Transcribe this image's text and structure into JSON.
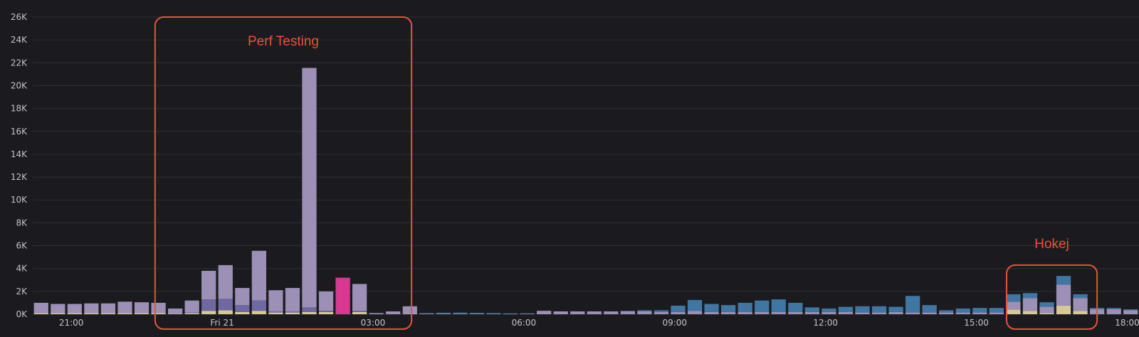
{
  "colors": {
    "background": "#1b1b1f",
    "grid": "#2f2f35",
    "tick_text": "#c4c4c8",
    "annotation": "#e8513a"
  },
  "chart_data": {
    "type": "bar",
    "stacked": true,
    "grid": true,
    "legend": "none",
    "ylim": [
      0,
      26000
    ],
    "y_ticks": [
      {
        "value": 0,
        "label": "0K"
      },
      {
        "value": 2000,
        "label": "2K"
      },
      {
        "value": 4000,
        "label": "4K"
      },
      {
        "value": 6000,
        "label": "6K"
      },
      {
        "value": 8000,
        "label": "8K"
      },
      {
        "value": 10000,
        "label": "10K"
      },
      {
        "value": 12000,
        "label": "12K"
      },
      {
        "value": 14000,
        "label": "14K"
      },
      {
        "value": 16000,
        "label": "16K"
      },
      {
        "value": 18000,
        "label": "18K"
      },
      {
        "value": 20000,
        "label": "20K"
      },
      {
        "value": 22000,
        "label": "22K"
      },
      {
        "value": 24000,
        "label": "24K"
      },
      {
        "value": 26000,
        "label": "26K"
      }
    ],
    "x_ticks": [
      {
        "index": 2.3,
        "label": "21:00"
      },
      {
        "index": 11.3,
        "label": "Fri 21"
      },
      {
        "index": 20.3,
        "label": "03:00"
      },
      {
        "index": 29.3,
        "label": "06:00"
      },
      {
        "index": 38.3,
        "label": "09:00"
      },
      {
        "index": 47.3,
        "label": "12:00"
      },
      {
        "index": 56.3,
        "label": "15:00"
      },
      {
        "index": 65.3,
        "label": "18:00"
      }
    ],
    "series": [
      {
        "color": "#d6c997",
        "values": [
          100,
          100,
          100,
          100,
          100,
          100,
          100,
          100,
          50,
          100,
          300,
          350,
          200,
          300,
          150,
          150,
          200,
          200,
          0,
          200,
          0,
          0,
          50,
          0,
          0,
          0,
          0,
          0,
          0,
          0,
          0,
          0,
          0,
          0,
          0,
          0,
          0,
          0,
          0,
          0,
          0,
          0,
          0,
          0,
          0,
          0,
          0,
          0,
          0,
          0,
          0,
          0,
          0,
          0,
          0,
          0,
          0,
          0,
          400,
          300,
          100,
          750,
          300,
          0,
          0,
          0
        ]
      },
      {
        "color": "#7068a2",
        "values": [
          0,
          0,
          0,
          0,
          0,
          0,
          0,
          0,
          0,
          50,
          1000,
          1000,
          600,
          900,
          100,
          100,
          400,
          100,
          0,
          100,
          0,
          0,
          0,
          0,
          0,
          0,
          0,
          0,
          0,
          0,
          0,
          0,
          0,
          0,
          0,
          0,
          0,
          0,
          0,
          0,
          0,
          0,
          0,
          0,
          0,
          0,
          0,
          0,
          0,
          0,
          0,
          0,
          0,
          0,
          0,
          0,
          0,
          0,
          0,
          0,
          0,
          0,
          0,
          0,
          0,
          0
        ]
      },
      {
        "color": "#9c90b6",
        "values": [
          900,
          800,
          800,
          850,
          850,
          1000,
          950,
          900,
          450,
          1050,
          2500,
          2950,
          1500,
          4350,
          1850,
          2050,
          20950,
          1700,
          0,
          2350,
          100,
          250,
          650,
          50,
          50,
          40,
          40,
          40,
          30,
          40,
          300,
          250,
          250,
          250,
          250,
          250,
          250,
          200,
          200,
          300,
          200,
          200,
          200,
          200,
          200,
          200,
          200,
          200,
          200,
          150,
          150,
          200,
          150,
          150,
          150,
          150,
          150,
          150,
          700,
          1100,
          550,
          1850,
          1100,
          450,
          450,
          350
        ]
      },
      {
        "color": "#d63a90",
        "values": [
          0,
          0,
          0,
          0,
          0,
          0,
          0,
          0,
          0,
          0,
          0,
          0,
          0,
          0,
          0,
          0,
          0,
          0,
          3200,
          0,
          0,
          0,
          0,
          0,
          0,
          0,
          0,
          0,
          0,
          0,
          0,
          0,
          0,
          0,
          0,
          0,
          0,
          0,
          0,
          0,
          0,
          0,
          0,
          0,
          0,
          0,
          0,
          0,
          0,
          0,
          0,
          0,
          0,
          0,
          0,
          0,
          0,
          0,
          0,
          0,
          0,
          0,
          0,
          0,
          0,
          0
        ]
      },
      {
        "color": "#3f77a2",
        "values": [
          0,
          0,
          0,
          0,
          0,
          0,
          0,
          0,
          0,
          0,
          0,
          0,
          0,
          0,
          0,
          0,
          0,
          0,
          0,
          0,
          0,
          0,
          0,
          50,
          80,
          100,
          80,
          60,
          40,
          40,
          0,
          0,
          0,
          0,
          0,
          50,
          100,
          150,
          550,
          950,
          700,
          600,
          800,
          1000,
          1100,
          800,
          400,
          300,
          450,
          550,
          550,
          450,
          1450,
          650,
          200,
          350,
          400,
          400,
          650,
          450,
          400,
          750,
          350,
          100,
          100,
          80
        ]
      }
    ]
  },
  "annotations": [
    {
      "label": "Perf Testing",
      "x_range": [
        7.3,
        22.6
      ],
      "y_range": [
        -1300,
        26000
      ]
    },
    {
      "label": "Hokej",
      "x_range": [
        58.1,
        63.5
      ],
      "y_range": [
        -1300,
        4300
      ]
    }
  ]
}
